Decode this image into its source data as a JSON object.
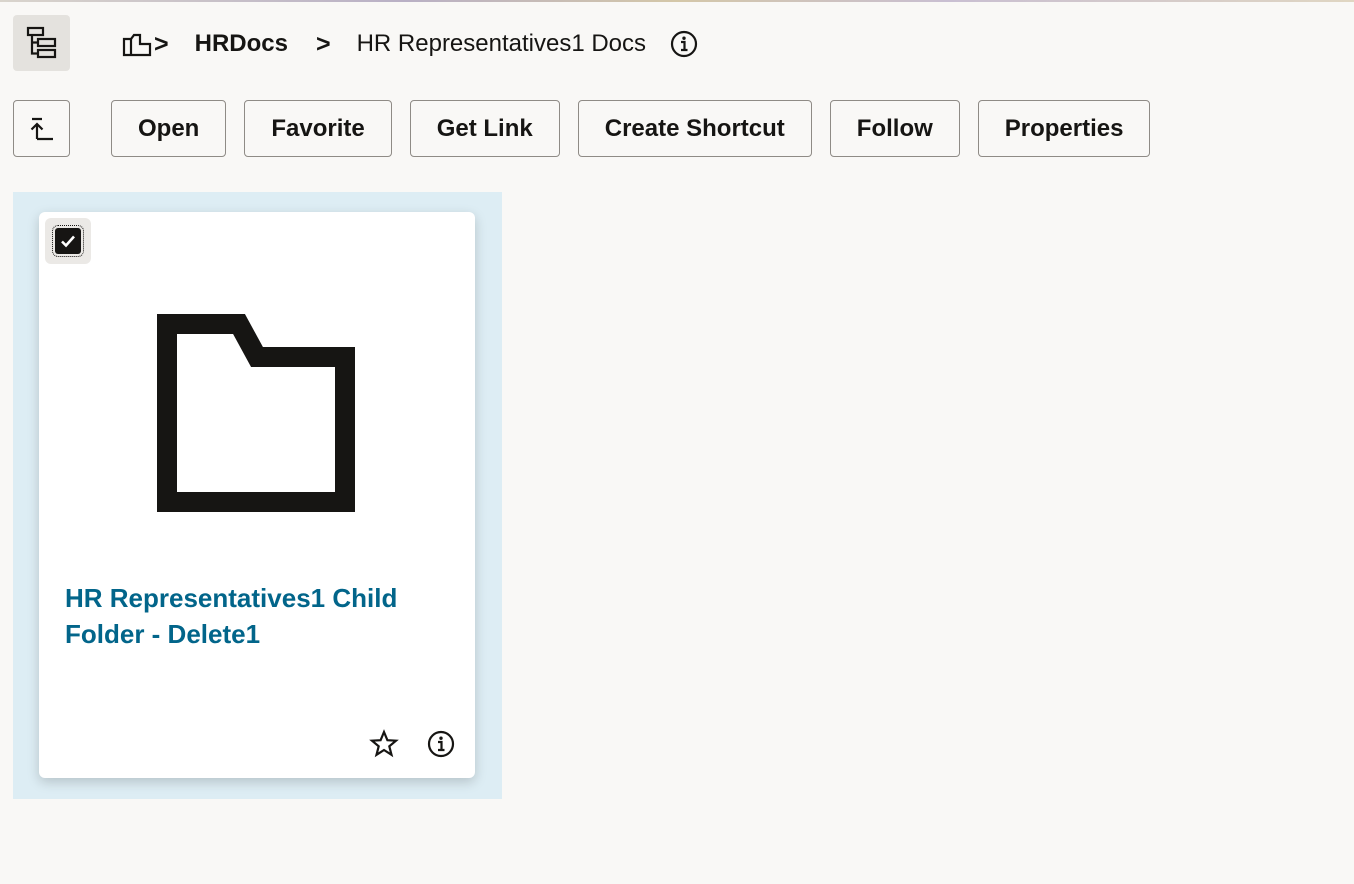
{
  "header": {
    "breadcrumb": {
      "root_separator": ">",
      "parent": "HRDocs",
      "separator": ">",
      "current": "HR Representatives1 Docs"
    }
  },
  "toolbar": {
    "buttons": [
      {
        "label": "Open"
      },
      {
        "label": "Favorite"
      },
      {
        "label": "Get Link"
      },
      {
        "label": "Create Shortcut"
      },
      {
        "label": "Follow"
      },
      {
        "label": "Properties"
      }
    ]
  },
  "items": [
    {
      "name": "HR Representatives1 Child Folder - Delete1",
      "type": "folder",
      "selected": true
    }
  ],
  "colors": {
    "accent_link": "#02658a",
    "selection_bg": "#ddedf4",
    "page_bg": "#f9f8f6"
  }
}
